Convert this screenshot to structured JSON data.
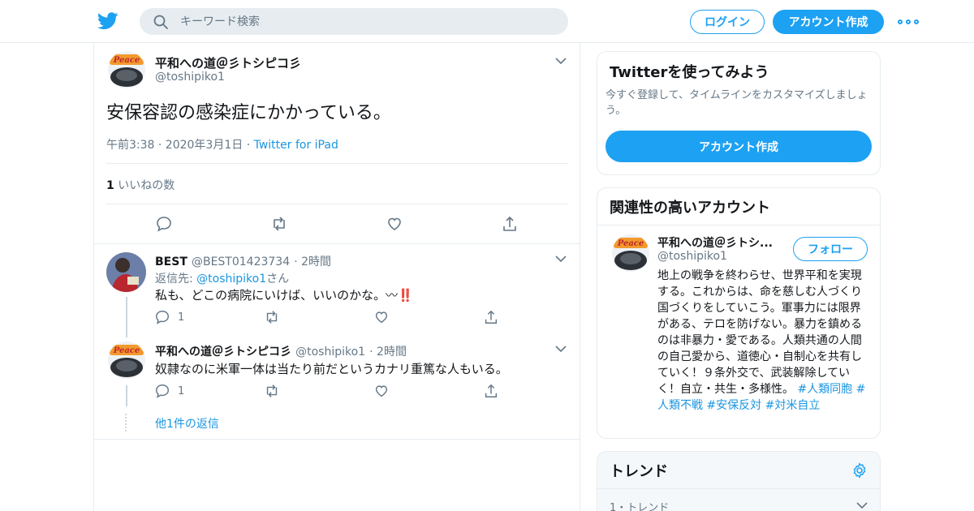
{
  "header": {
    "search_placeholder": "キーワード検索",
    "login_label": "ログイン",
    "signup_label": "アカウント作成"
  },
  "tweet": {
    "author_name": "平和への道＠彡トシピコ彡",
    "author_handle": "@toshipiko1",
    "text": "安保容認の感染症にかかっている。",
    "timestamp": "午前3:38 · 2020年3月1日",
    "meta_sep": "·",
    "source": "Twitter for iPad",
    "likes_count": "1",
    "likes_label": "いいねの数"
  },
  "replies": [
    {
      "name": "BEST",
      "handle": "@BEST01423734",
      "time": "· 2時間",
      "reply_to_prefix": "返信先: ",
      "reply_to_handle": "@toshipiko1",
      "reply_to_suffix": "さん",
      "text": "私も、どこの病院にいけば、いいのかな。〰‼️",
      "reply_count": "1"
    },
    {
      "name": "平和への道＠彡トシピコ彡",
      "handle": "@toshipiko1",
      "time": "· 2時間",
      "text": "奴隷なのに米軍一体は当たり前だというカナリ重篤な人もいる。",
      "reply_count": "1"
    }
  ],
  "more_replies_label": "他1件の返信",
  "sidebar": {
    "try_twitter": {
      "title": "Twitterを使ってみよう",
      "desc": "今すぐ登録して、タイムラインをカスタマイズしましょう。",
      "button": "アカウント作成"
    },
    "related": {
      "title": "関連性の高いアカウント",
      "name": "平和への道＠彡トシ...",
      "handle": "@toshipiko1",
      "follow_label": "フォロー",
      "bio": "地上の戦争を終わらせ、世界平和を実現する。これからは、命を慈しむ人づくり国づくりをしていこう。軍事力には限界がある、テロを防げない。暴力を鎮めるのは非暴力・愛である。人類共通の人間の自己愛から、道徳心・自制心を共有していく！９条外交で、武装解除していく！自立・共生・多様性。",
      "hashtags": [
        "#人類同胞",
        "#人類不戦",
        "#安保反対",
        "#対米自立"
      ]
    },
    "trends": {
      "title": "トレンド",
      "first_item_label": "1・トレンド"
    }
  },
  "avatar_logo_text": "Peace",
  "colors": {
    "brand_blue": "#1da1f2",
    "link_blue": "#1b95e0",
    "grey_text": "#657786",
    "border": "#e6ecf0",
    "alert_red": "#e0245e"
  }
}
